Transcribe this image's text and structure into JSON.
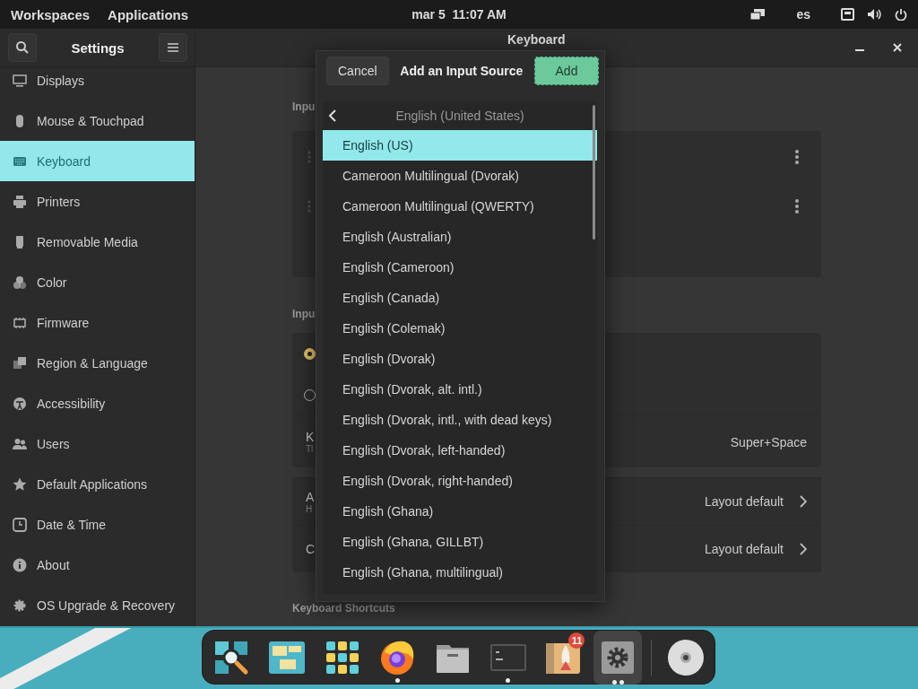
{
  "top_bar": {
    "menus": [
      "Workspaces",
      "Applications"
    ],
    "clock": "mar 5  11:07 AM",
    "language": "es"
  },
  "window": {
    "sidebar_title": "Settings",
    "title": "Keyboard"
  },
  "sidebar": {
    "items": [
      {
        "label": "Displays",
        "selected": false
      },
      {
        "label": "Mouse & Touchpad",
        "selected": false
      },
      {
        "label": "Keyboard",
        "selected": true
      },
      {
        "label": "Printers",
        "selected": false
      },
      {
        "label": "Removable Media",
        "selected": false
      },
      {
        "label": "Color",
        "selected": false
      },
      {
        "label": "Firmware",
        "selected": false
      },
      {
        "label": "Region & Language",
        "selected": false
      },
      {
        "label": "Accessibility",
        "selected": false
      },
      {
        "label": "Users",
        "selected": false
      },
      {
        "label": "Default Applications",
        "selected": false
      },
      {
        "label": "Date & Time",
        "selected": false
      },
      {
        "label": "About",
        "selected": false
      },
      {
        "label": "OS Upgrade & Recovery",
        "selected": false
      }
    ]
  },
  "main": {
    "sources_heading": "Inpu",
    "source_rows": [
      {
        "kind": "source"
      },
      {
        "kind": "source"
      }
    ],
    "switching_heading": "Inpu",
    "options": [
      {
        "selected": true
      },
      {
        "selected": false
      }
    ],
    "shortcut_row": {
      "label": "K",
      "sublabel": "Tl",
      "value": "Super+Space"
    },
    "layout_rows": [
      {
        "label": "A",
        "sublabel": "H",
        "value": "Layout default"
      },
      {
        "label": "C",
        "value": "Layout default"
      }
    ],
    "shortcuts_heading": "Keyboard Shortcuts"
  },
  "dialog": {
    "cancel": "Cancel",
    "title": "Add an Input Source",
    "add": "Add",
    "group": "English (United States)",
    "items": [
      {
        "label": "English (US)",
        "selected": true
      },
      {
        "label": "Cameroon Multilingual (Dvorak)",
        "selected": false
      },
      {
        "label": "Cameroon Multilingual (QWERTY)",
        "selected": false
      },
      {
        "label": "English (Australian)",
        "selected": false
      },
      {
        "label": "English (Cameroon)",
        "selected": false
      },
      {
        "label": "English (Canada)",
        "selected": false
      },
      {
        "label": "English (Colemak)",
        "selected": false
      },
      {
        "label": "English (Dvorak)",
        "selected": false
      },
      {
        "label": "English (Dvorak, alt. intl.)",
        "selected": false
      },
      {
        "label": "English (Dvorak, intl., with dead keys)",
        "selected": false
      },
      {
        "label": "English (Dvorak, left-handed)",
        "selected": false
      },
      {
        "label": "English (Dvorak, right-handed)",
        "selected": false
      },
      {
        "label": "English (Ghana)",
        "selected": false
      },
      {
        "label": "English (Ghana, GILLBT)",
        "selected": false
      },
      {
        "label": "English (Ghana, multilingual)",
        "selected": false
      }
    ]
  },
  "dock": {
    "items": [
      {
        "kind": "search",
        "running": false,
        "selected": false
      },
      {
        "kind": "workspaces",
        "running": false,
        "selected": false
      },
      {
        "kind": "apps",
        "running": false,
        "selected": false
      },
      {
        "kind": "browser",
        "running": true,
        "selected": false
      },
      {
        "kind": "files",
        "running": false,
        "selected": false
      },
      {
        "kind": "terminal",
        "running": true,
        "selected": false
      },
      {
        "kind": "shop",
        "running": false,
        "selected": false,
        "badge": "11"
      },
      {
        "kind": "settings",
        "running": true,
        "selected": true
      },
      {
        "kind": "separator"
      },
      {
        "kind": "disc",
        "running": false,
        "selected": false
      }
    ]
  }
}
